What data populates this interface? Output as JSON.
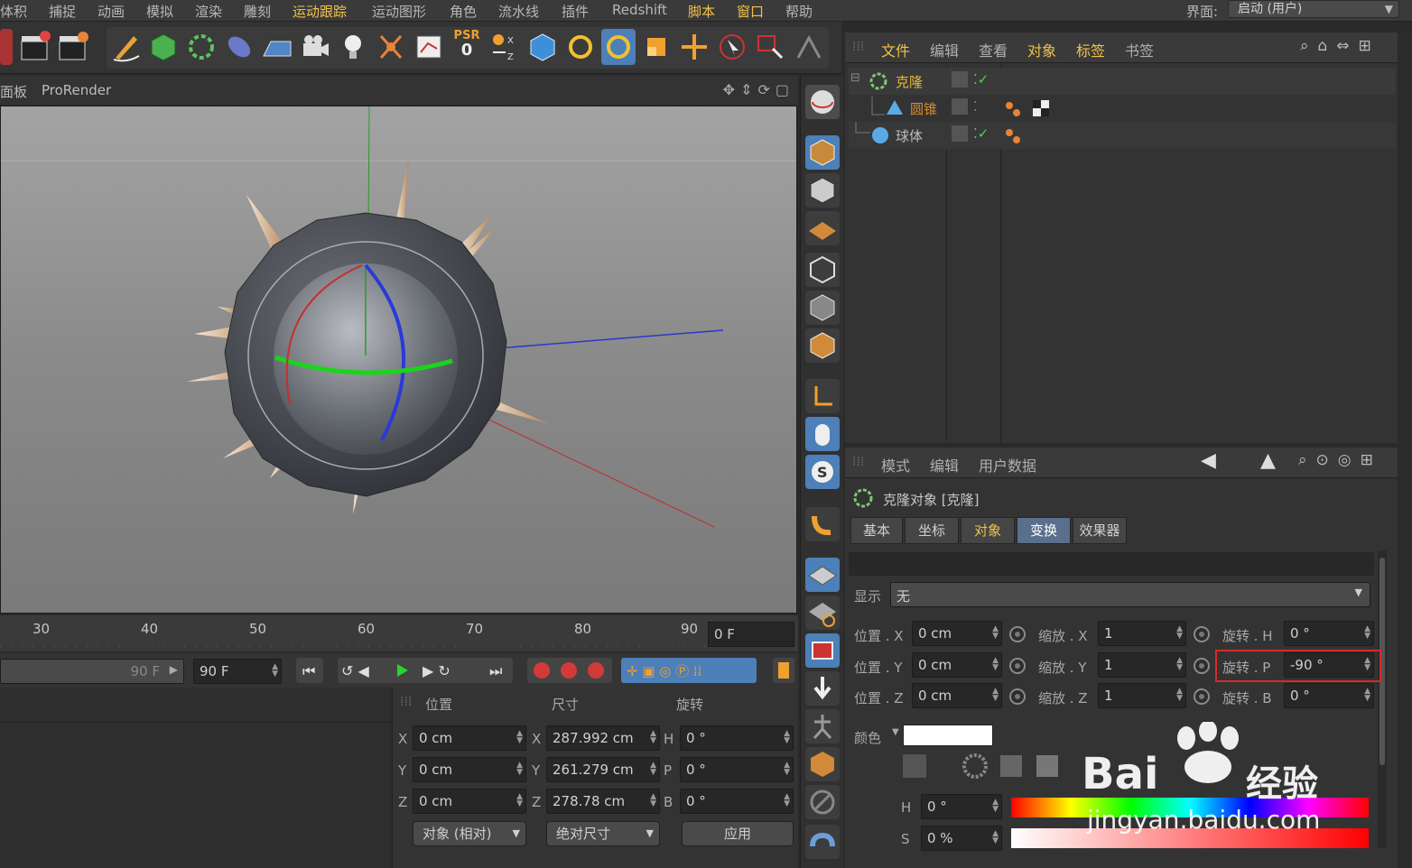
{
  "menubar": {
    "items": [
      "体积",
      "捕捉",
      "动画",
      "模拟",
      "渲染",
      "雕刻",
      "运动跟踪",
      "运动图形",
      "角色",
      "流水线",
      "插件",
      "Redshift",
      "脚本",
      "窗口",
      "帮助"
    ],
    "layout_label": "界面:",
    "layout_value": "启动 (用户)"
  },
  "toolbar": {
    "psr_label": "PSR",
    "psr_value": "0"
  },
  "viewport_header": {
    "panel_label": "面板",
    "prorender_label": "ProRender"
  },
  "timeline": {
    "ticks": [
      "30",
      "40",
      "50",
      "60",
      "70",
      "80",
      "90"
    ],
    "current_frame": "0 F",
    "end_frame_slider": "90 F",
    "end_frame_field": "90 F"
  },
  "coords": {
    "header": {
      "position": "位置",
      "size": "尺寸",
      "rotation": "旋转"
    },
    "axes": [
      "X",
      "Y",
      "Z"
    ],
    "rot_axes": [
      "H",
      "P",
      "B"
    ],
    "position": [
      "0 cm",
      "0 cm",
      "0 cm"
    ],
    "size": [
      "287.992 cm",
      "261.279 cm",
      "278.78 cm"
    ],
    "rotation": [
      "0 °",
      "0 °",
      "0 °"
    ],
    "mode_select": "对象 (相对)",
    "size_select": "绝对尺寸",
    "apply_button": "应用"
  },
  "object_manager": {
    "menu": [
      "文件",
      "编辑",
      "查看",
      "对象",
      "标签",
      "书签"
    ],
    "objects": [
      {
        "name": "克隆",
        "color": "#e6b83c"
      },
      {
        "name": "圆锥",
        "color": "#d98a2a"
      },
      {
        "name": "球体",
        "color": "#bdbdbd"
      }
    ]
  },
  "attribute_manager": {
    "menu": [
      "模式",
      "编辑",
      "用户数据"
    ],
    "title": "克隆对象 [克隆]",
    "tabs": [
      "基本",
      "坐标",
      "对象",
      "变换",
      "效果器"
    ],
    "active_tab": "变换",
    "display_label": "显示",
    "display_value": "无",
    "fields": {
      "pos_x_label": "位置 . X",
      "pos_x": "0 cm",
      "pos_y_label": "位置 . Y",
      "pos_y": "0 cm",
      "pos_z_label": "位置 . Z",
      "pos_z": "0 cm",
      "scale_x_label": "缩放 . X",
      "scale_x": "1",
      "scale_y_label": "缩放 . Y",
      "scale_y": "1",
      "scale_z_label": "缩放 . Z",
      "scale_z": "1",
      "rot_h_label": "旋转 . H",
      "rot_h": "0 °",
      "rot_p_label": "旋转 . P",
      "rot_p": "-90 °",
      "rot_b_label": "旋转 . B",
      "rot_b": "0 °"
    },
    "color_label": "颜色",
    "h_label": "H",
    "h_value": "0 °",
    "s_label": "S",
    "s_value": "0 %"
  },
  "watermark": {
    "brand": "Bai",
    "brand_tail": "经验",
    "url": "jingyan.baidu.com"
  },
  "colors": {
    "accent": "#f2c24a",
    "highlight_box": "#d62a2a",
    "active_tab": "#5a6f8c"
  }
}
